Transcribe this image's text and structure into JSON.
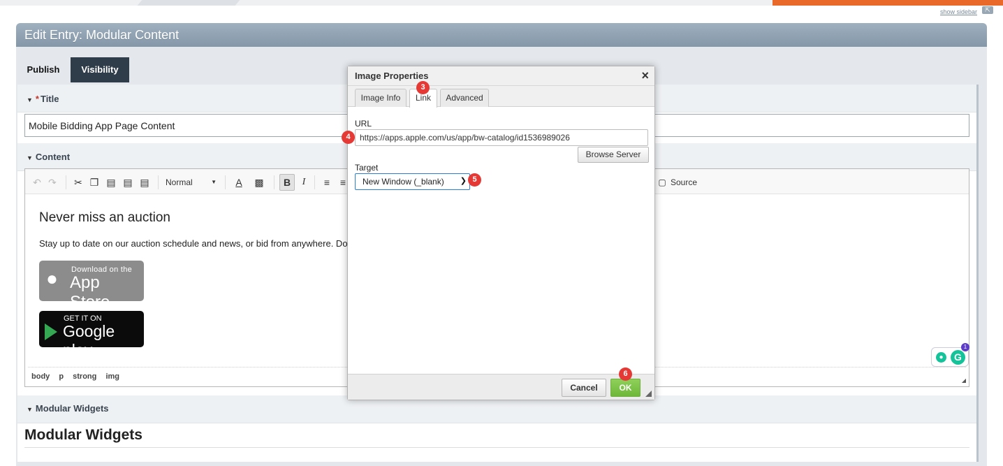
{
  "top": {
    "show_sidebar": "show sidebar"
  },
  "header": {
    "title": "Edit Entry: Modular Content"
  },
  "tabs": [
    {
      "label": "Publish"
    },
    {
      "label": "Visibility"
    }
  ],
  "title_field": {
    "label": "Title",
    "required_mark": "*",
    "value": "Mobile Bidding App Page Content"
  },
  "content_field": {
    "label": "Content",
    "toolbar": {
      "format": "Normal",
      "source": "Source"
    },
    "heading": "Never miss an auction",
    "paragraph": "Stay up to date on our auction schedule and news, or bid from anywhere. Do",
    "paragraph_tail": ".",
    "app_store": {
      "small": "Download on the",
      "large": "App Store"
    },
    "google_play": {
      "small": "GET IT ON",
      "large": "Google play"
    },
    "grammarly_badge": "1",
    "path": [
      "body",
      "p",
      "strong",
      "img"
    ]
  },
  "modular_widgets": {
    "section_label": "Modular Widgets",
    "heading": "Modular Widgets"
  },
  "dialog": {
    "title": "Image Properties",
    "tabs": [
      "Image Info",
      "Link",
      "Advanced"
    ],
    "url_label": "URL",
    "url_value": "https://apps.apple.com/us/app/bw-catalog/id1536989026",
    "browse_label": "Browse Server",
    "target_label": "Target",
    "target_value": "New Window (_blank)",
    "cancel_label": "Cancel",
    "ok_label": "OK"
  },
  "markers": [
    "3",
    "4",
    "5",
    "6"
  ],
  "colors": {
    "header": "#8fa2b3",
    "visibility_tab": "#2f3c4a",
    "ok_button": "#7cc24a",
    "marker": "#e53935",
    "accent_orange": "#e8692a"
  }
}
